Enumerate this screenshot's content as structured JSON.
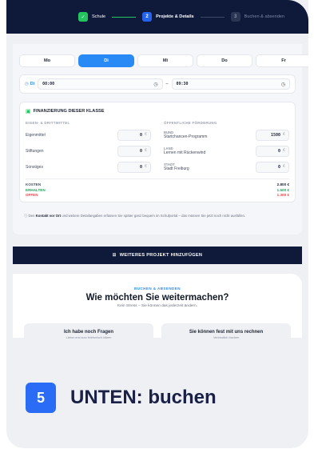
{
  "stepper": {
    "steps": [
      {
        "num": "✓",
        "label": "Schule",
        "state": "done"
      },
      {
        "num": "2",
        "label": "Projekte & Details",
        "state": "active"
      },
      {
        "num": "3",
        "label": "Buchen & absenden",
        "state": "todo"
      }
    ]
  },
  "days": [
    "Mo",
    "Di",
    "Mi",
    "Do",
    "Fr"
  ],
  "selected_day": "Di",
  "time": {
    "label": "Di",
    "from": "08:00",
    "separator": "–",
    "to": "09:30"
  },
  "finance": {
    "title": "FINANZIERUNG DIESER KLASSE",
    "left_header": "EIGEN- & DRITTMITTEL",
    "left_rows": [
      {
        "label": "Eigenmittel",
        "value": "0",
        "currency": "€"
      },
      {
        "label": "Stiftungen",
        "value": "0",
        "currency": "€"
      },
      {
        "label": "Sonstiges",
        "value": "0",
        "currency": "€"
      }
    ],
    "right_header": "ÖFFENTLICHE FÖRDERUNG",
    "right_rows": [
      {
        "sub": "BUND",
        "label": "Startchancen-Programm",
        "value": "1500",
        "currency": "€"
      },
      {
        "sub": "LAND",
        "label": "Lernen mit Rückenwind",
        "value": "0",
        "currency": "€"
      },
      {
        "sub": "STADT",
        "label": "Stadt Freiburg",
        "value": "0",
        "currency": "€"
      }
    ],
    "totals": [
      {
        "label": "KOSTEN",
        "value": "2.800 €"
      },
      {
        "label": "ERHALTEN",
        "value": "1.500 €"
      },
      {
        "label": "OFFEN",
        "value": "1.300 €"
      }
    ]
  },
  "note": {
    "prefix": "Den",
    "bold": "Kontakt vor Ort",
    "rest": "und weitere Detailangaben erfassen Sie später ganz bequem im Schulportal – das müssen Sie jetzt noch nicht ausfüllen."
  },
  "add_project_label": "WEITERES PROJEKT HINZUFÜGEN",
  "decide": {
    "kicker": "BUCHEN & ABSENDEN",
    "heading": "Wie möchten Sie weitermachen?",
    "subtitle": "Kein Stress – Sie können das jederzeit ändern.",
    "options": [
      {
        "title": "Ich habe noch Fragen",
        "desc": "Lieber erst kurz telefonisch klären"
      },
      {
        "title": "Sie können fest mit uns rechnen",
        "desc": "Verbindlich buchen"
      }
    ]
  },
  "banner": {
    "number": "5",
    "text": "UNTEN: buchen"
  },
  "colors": {
    "primary": "#2a8af5",
    "navy": "#0f1a3a",
    "success": "#22c55e",
    "danger": "#e5484d"
  }
}
